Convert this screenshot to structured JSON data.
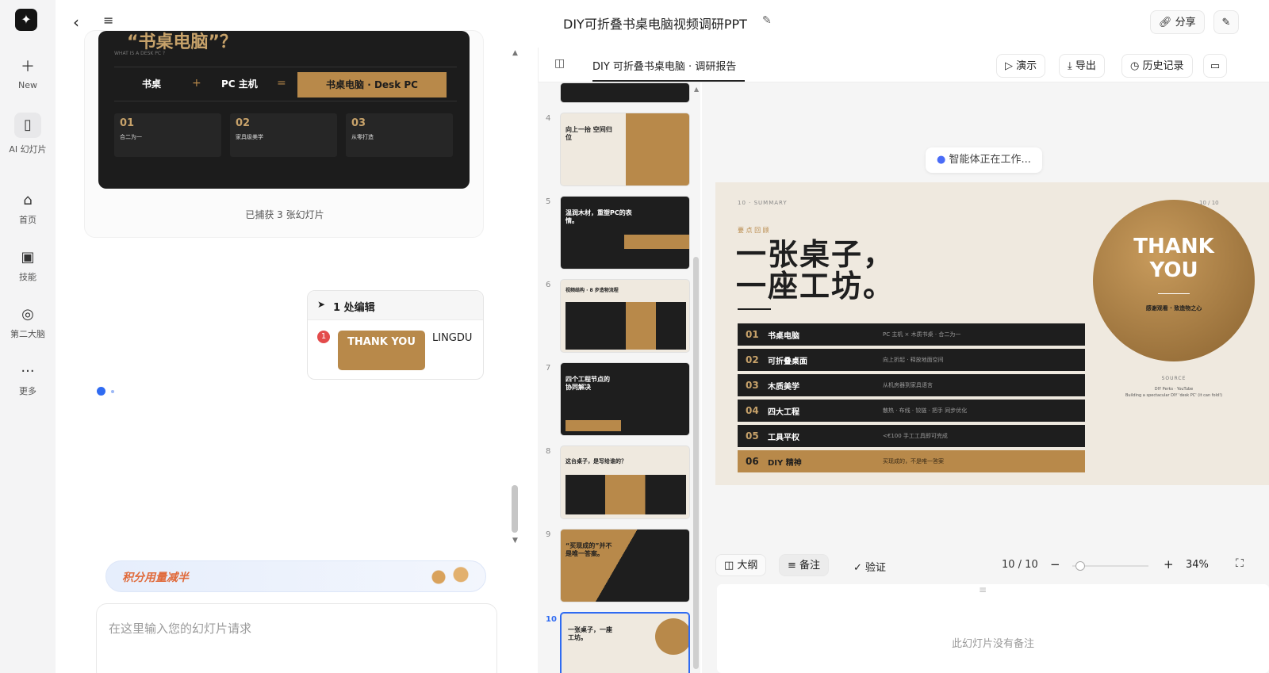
{
  "rail": {
    "items": [
      {
        "label": "New"
      },
      {
        "label": "AI 幻灯片"
      },
      {
        "label": "首页"
      },
      {
        "label": "技能"
      },
      {
        "label": "第二大脑"
      },
      {
        "label": "更多"
      }
    ]
  },
  "header": {
    "title": "DIY可折叠书桌电脑视频调研PPT",
    "share": "分享"
  },
  "chat": {
    "preview": {
      "title": "“书桌电脑”？",
      "sub": "WHAT IS A DESK PC ?",
      "eq": [
        "书桌",
        "PC 主机",
        "书桌电脑 · Desk PC"
      ],
      "plus": "+",
      "equals": "=",
      "cols": [
        {
          "num": "01",
          "label": "合二为一"
        },
        {
          "num": "02",
          "label": "家具级美学"
        },
        {
          "num": "03",
          "label": "从零打造"
        }
      ]
    },
    "captured": "已捕获 3 张幻灯片",
    "edit_title": "1 处编辑",
    "edit_badge": "1",
    "edit_thumb": "THANK YOU",
    "edit_name": "LINGDU",
    "promo": "积分用量减半",
    "input_placeholder": "在这里输入您的幻灯片请求"
  },
  "doc": {
    "tab": "DIY 可折叠书桌电脑 · 调研报告",
    "present": "演示",
    "export": "导出",
    "history": "历史记录",
    "agent_status": "智能体正在工作..."
  },
  "thumbs": [
    {
      "num": "4",
      "text": "向上一抬 空间归位"
    },
    {
      "num": "5",
      "text": "温润木材，重塑PC的表情。"
    },
    {
      "num": "6",
      "text": "视频结构 · 8 步造物流程"
    },
    {
      "num": "7",
      "text": "四个工程节点的协同解决"
    },
    {
      "num": "8",
      "text": "这台桌子，是写给谁的？"
    },
    {
      "num": "9",
      "text": "“买现成的”并不是唯一答案。"
    },
    {
      "num": "10",
      "text": "一张桌子，一座工坊。"
    }
  ],
  "slide": {
    "tag": "10 · SUMMARY",
    "page": "10 / 10",
    "kicker": "要 点 回 顾",
    "title1": "一张桌子，",
    "title2": "一座工坊。",
    "rows": [
      {
        "n": "01",
        "k": "书桌电脑",
        "d": "PC 主机 × 木质书桌 · 合二为一"
      },
      {
        "n": "02",
        "k": "可折叠桌面",
        "d": "向上折起 · 释放地面空间"
      },
      {
        "n": "03",
        "k": "木质美学",
        "d": "从机房器到家具语言"
      },
      {
        "n": "04",
        "k": "四大工程",
        "d": "散热 · 布线 · 铰链 · 把手 同步优化"
      },
      {
        "n": "05",
        "k": "工具平权",
        "d": "<€100 手工工具即可完成"
      },
      {
        "n": "06",
        "k": "DIY 精神",
        "d": "买现成的，不是唯一答案"
      }
    ],
    "circle1": "THANK",
    "circle2": "YOU",
    "circle_sub": "感谢观看 · 致造物之心",
    "source_label": "SOURCE",
    "source1": "DIY Perks · YouTube",
    "source2": "Building a spectacular DIY 'desk PC' (it can fold!)"
  },
  "bottom": {
    "outline": "大纲",
    "notes": "备注",
    "verify": "验证",
    "pager": "10 / 10",
    "minus": "−",
    "plus": "+",
    "zoom": "34%",
    "zoom_level": 0.1,
    "no_notes": "此幻灯片没有备注"
  },
  "colors": {
    "gold": "#b8894a",
    "dark": "#1e1e1e",
    "cream": "#efe9df",
    "accent": "#4a6cf7"
  }
}
